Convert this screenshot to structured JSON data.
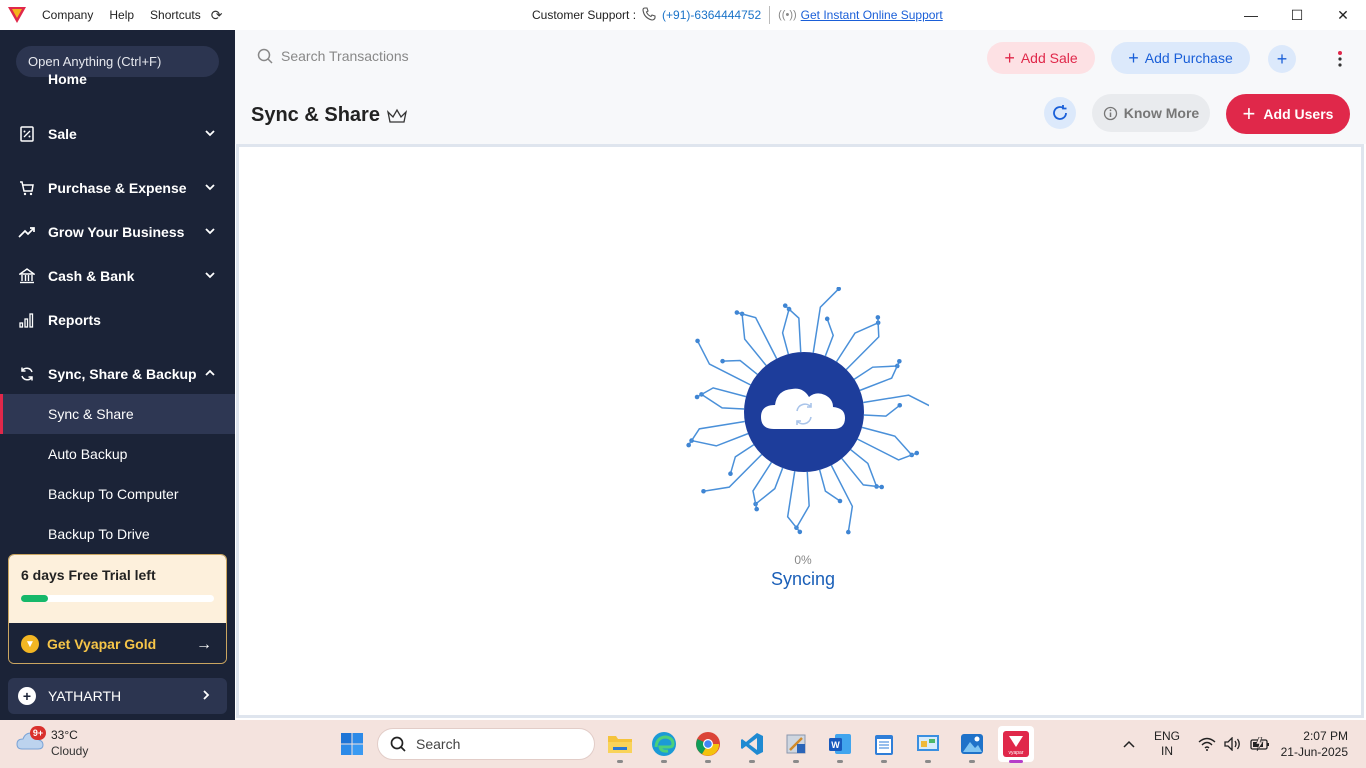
{
  "titlebar": {
    "menu": [
      "Company",
      "Help",
      "Shortcuts"
    ],
    "support_label": "Customer Support :",
    "support_phone": "(+91)-6364444752",
    "support_link": "Get Instant Online Support"
  },
  "sidebar": {
    "search_placeholder": "Open Anything (Ctrl+F)",
    "items": [
      {
        "label": "Home"
      },
      {
        "label": "Sale"
      },
      {
        "label": "Purchase & Expense"
      },
      {
        "label": "Grow Your Business"
      },
      {
        "label": "Cash & Bank"
      },
      {
        "label": "Reports"
      },
      {
        "label": "Sync, Share & Backup"
      }
    ],
    "subitems": [
      {
        "label": "Sync & Share"
      },
      {
        "label": "Auto Backup"
      },
      {
        "label": "Backup To Computer"
      },
      {
        "label": "Backup To Drive"
      }
    ],
    "trial": {
      "title": "6 days Free Trial left",
      "progress": 0.14,
      "cta": "Get Vyapar Gold"
    },
    "company": "YATHARTH"
  },
  "topbar": {
    "search_placeholder": "Search Transactions",
    "add_sale": "Add Sale",
    "add_purchase": "Add Purchase"
  },
  "page": {
    "title": "Sync & Share",
    "know_more": "Know More",
    "add_users": "Add Users",
    "percent": "0%",
    "status": "Syncing"
  },
  "taskbar": {
    "weather_badge": "9+",
    "temperature": "33°C",
    "condition": "Cloudy",
    "search": "Search",
    "lang_top": "ENG",
    "lang_bottom": "IN",
    "time": "2:07 PM",
    "date": "21-Jun-2025"
  },
  "colors": {
    "sidebar_bg": "#1b2337",
    "accent_red": "#e0284a",
    "accent_blue": "#1a5fd8",
    "cloud_circle": "#1d3d9b"
  }
}
